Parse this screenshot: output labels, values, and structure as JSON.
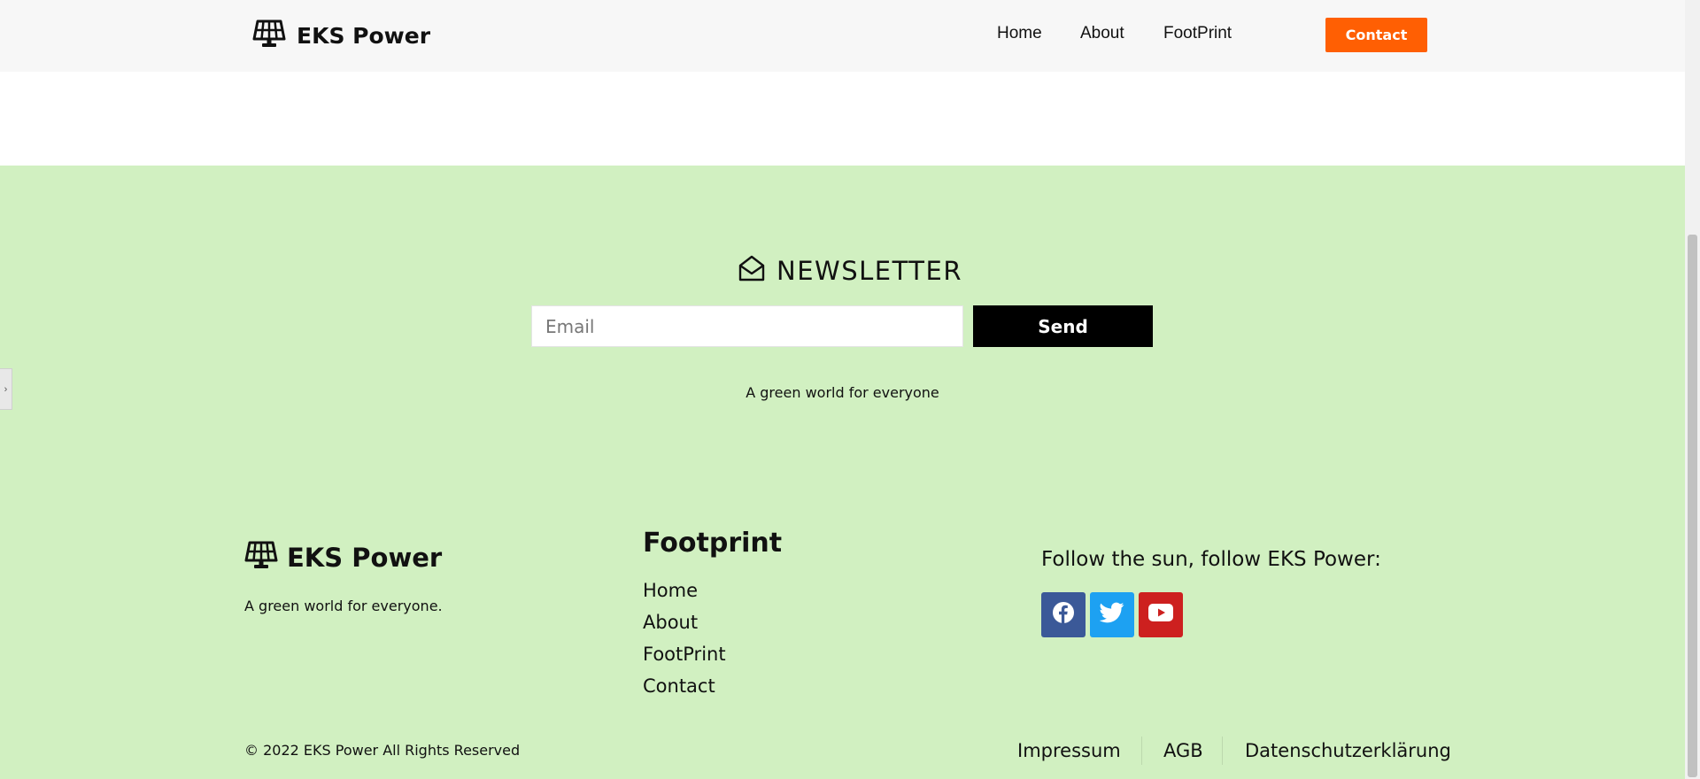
{
  "header": {
    "brand": "EKS Power",
    "brand_icon": "solar-panel-icon",
    "nav": [
      "Home",
      "About",
      "FootPrint"
    ],
    "contact_label": "Contact"
  },
  "newsletter": {
    "icon": "envelope-open-icon",
    "title": "NEWSLETTER",
    "email_placeholder": "Email",
    "send_label": "Send",
    "tagline": "A green world for everyone"
  },
  "footer": {
    "brand": "EKS Power",
    "brand_icon": "solar-panel-icon",
    "tagline": "A green world for everyone.",
    "links_title": "Footprint",
    "links": [
      "Home",
      "About",
      "FootPrint",
      "Contact"
    ],
    "follow_title": "Follow the sun, follow EKS Power:",
    "social": [
      {
        "name": "facebook-icon",
        "color": "#3b5998"
      },
      {
        "name": "twitter-icon",
        "color": "#1da1f2"
      },
      {
        "name": "youtube-icon",
        "color": "#cd201f"
      }
    ],
    "copyright": "© 2022 EKS Power All Rights Reserved",
    "legal": [
      "Impressum",
      "AGB",
      "Datenschutzerklärung"
    ]
  },
  "colors": {
    "accent": "#ff5f03",
    "green_background": "#d1f0c1",
    "header_background": "#f7f7f7"
  }
}
